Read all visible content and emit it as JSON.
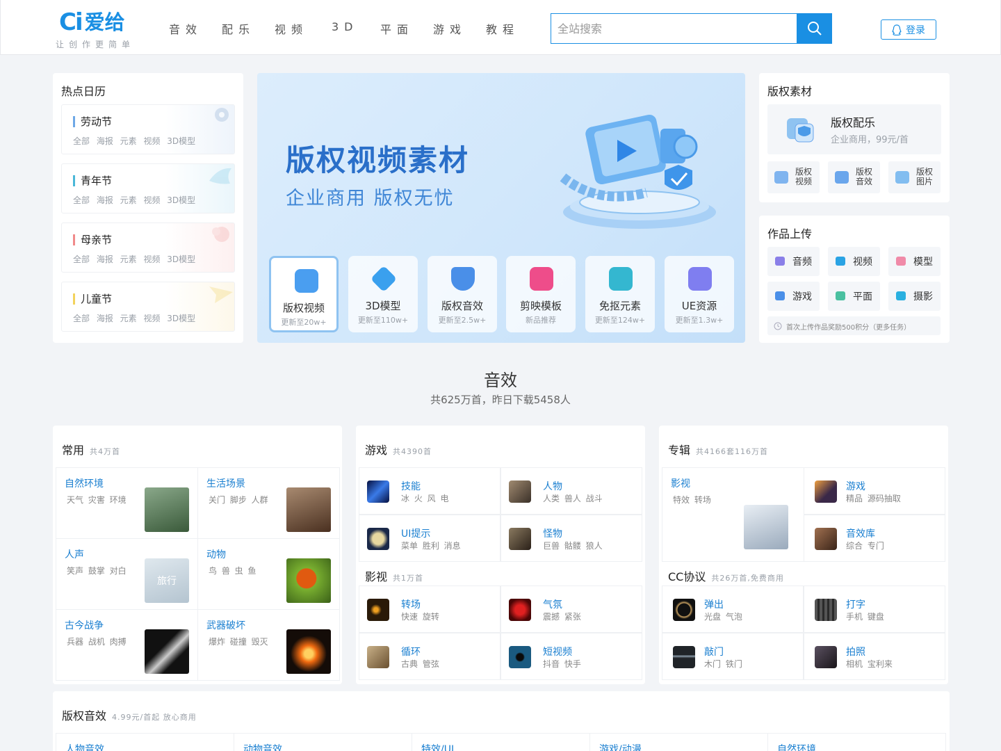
{
  "header": {
    "logo_mark": "Ci",
    "logo_text": "爱给",
    "slogan": "让创作更简单",
    "nav": [
      "音效",
      "配乐",
      "视频",
      "3D",
      "平面",
      "游戏",
      "教程"
    ],
    "search_placeholder": "全站搜索",
    "login_label": "登录",
    "accent": "#1a8fe3"
  },
  "calendar": {
    "title": "热点日历",
    "items": [
      {
        "name": "劳动节",
        "tags": "全部 海报 元素 视频 3D模型",
        "color": "#6ea8e6"
      },
      {
        "name": "青年节",
        "tags": "全部 海报 元素 视频 3D模型",
        "color": "#4ab7d8"
      },
      {
        "name": "母亲节",
        "tags": "全部 海报 元素 视频 3D模型",
        "color": "#f08a8a"
      },
      {
        "name": "儿童节",
        "tags": "全部 海报 元素 视频 3D模型",
        "color": "#f3d25c"
      }
    ]
  },
  "banner": {
    "title": "版权视频素材",
    "subtitle": "企业商用  版权无忧",
    "cards": [
      {
        "label": "版权视频",
        "sub": "更新至20w+",
        "color": "#4a9ef0"
      },
      {
        "label": "3D模型",
        "sub": "更新至110w+",
        "color": "#3aa0ee"
      },
      {
        "label": "版权音效",
        "sub": "更新至2.5w+",
        "color": "#4a8fe8"
      },
      {
        "label": "剪映模板",
        "sub": "新品推荐",
        "color": "#ee4d8a"
      },
      {
        "label": "免抠元素",
        "sub": "更新至124w+",
        "color": "#34b7d0"
      },
      {
        "label": "UE资源",
        "sub": "更新至1.3w+",
        "color": "#7f7ef0"
      }
    ]
  },
  "copyright": {
    "title": "版权素材",
    "feature_name": "版权配乐",
    "feature_sub": "企业商用，99元/首",
    "minis": [
      {
        "label": "版权视频",
        "color": "#7fb4ef"
      },
      {
        "label": "版权音效",
        "color": "#6aa6ec"
      },
      {
        "label": "版权图片",
        "color": "#82bdf0"
      }
    ]
  },
  "upload": {
    "title": "作品上传",
    "items": [
      {
        "label": "音频",
        "color": "#8a7fe8"
      },
      {
        "label": "视频",
        "color": "#2aa3e4"
      },
      {
        "label": "模型",
        "color": "#f08aa8"
      },
      {
        "label": "游戏",
        "color": "#4a8fe8"
      },
      {
        "label": "平面",
        "color": "#4ac0a0"
      },
      {
        "label": "摄影",
        "color": "#2ab0e0"
      }
    ],
    "tip": "首次上传作品奖励500积分（更多任务）"
  },
  "section": {
    "title": "音效",
    "subtitle": "共625万首，昨日下载5458人"
  },
  "common": {
    "title": "常用",
    "count": "共4万首",
    "cells": [
      {
        "name": "自然环境",
        "tags": "天气 灾害 环境",
        "thumb": "#5a7a5a"
      },
      {
        "name": "生活场景",
        "tags": "关门 脚步 人群",
        "thumb": "#7a5a48"
      },
      {
        "name": "人声",
        "tags": "笑声 鼓掌 对白",
        "thumb": "#c9d6e0",
        "thumb_text": "旅行"
      },
      {
        "name": "动物",
        "tags": "鸟 兽 虫 鱼",
        "thumb": "#6aa030"
      },
      {
        "name": "古今战争",
        "tags": "兵器 战机 肉搏",
        "thumb": "#1a1a1a"
      },
      {
        "name": "武器破坏",
        "tags": "爆炸 碰撞 毁灭",
        "thumb": "#140c08"
      }
    ]
  },
  "game": {
    "title": "游戏",
    "count": "共4390首",
    "cells": [
      {
        "name": "技能",
        "tags": "冰 火 风 电",
        "thumb": "#1a3aa8"
      },
      {
        "name": "人物",
        "tags": "人类 兽人 战斗",
        "thumb": "#6a5a48"
      },
      {
        "name": "UI提示",
        "tags": "菜单 胜利 消息",
        "thumb": "#1a2848"
      },
      {
        "name": "怪物",
        "tags": "巨兽 骷髅 狼人",
        "thumb": "#5a4a3a"
      }
    ]
  },
  "film": {
    "title": "影视",
    "count": "共1万首",
    "cells": [
      {
        "name": "转场",
        "tags": "快速 旋转",
        "thumb": "#2a1a08"
      },
      {
        "name": "气氛",
        "tags": "震撼 紧张",
        "thumb": "#6a0a0a"
      },
      {
        "name": "循环",
        "tags": "古典 管弦",
        "thumb": "#a08a60"
      },
      {
        "name": "短视频",
        "tags": "抖音 快手",
        "thumb": "#1a5a80"
      }
    ]
  },
  "album": {
    "title": "专辑",
    "count": "共4166套116万首",
    "feature": {
      "name": "影视",
      "tags": "特效 转场",
      "thumb": "#b8c4d0"
    },
    "cells": [
      {
        "name": "游戏",
        "tags": "精品 源码抽取",
        "thumb": "#3a2848"
      },
      {
        "name": "音效库",
        "tags": "综合 专门",
        "thumb": "#6a4a30"
      }
    ]
  },
  "cc": {
    "title": "CC协议",
    "count": "共26万首,免费商用",
    "cells": [
      {
        "name": "弹出",
        "tags": "光盘 气泡",
        "thumb": "#101010"
      },
      {
        "name": "打字",
        "tags": "手机 键盘",
        "thumb": "#2a2a2a"
      },
      {
        "name": "敲门",
        "tags": "木门 铁门",
        "thumb": "#202428"
      },
      {
        "name": "拍照",
        "tags": "相机 宝利来",
        "thumb": "#28242a"
      }
    ]
  },
  "copyright_sfx": {
    "title": "版权音效",
    "count": "4.99元/首起 放心商用",
    "tabs": [
      "人物音效",
      "动物音效",
      "特效/UI",
      "游戏/动漫",
      "自然环境"
    ]
  }
}
